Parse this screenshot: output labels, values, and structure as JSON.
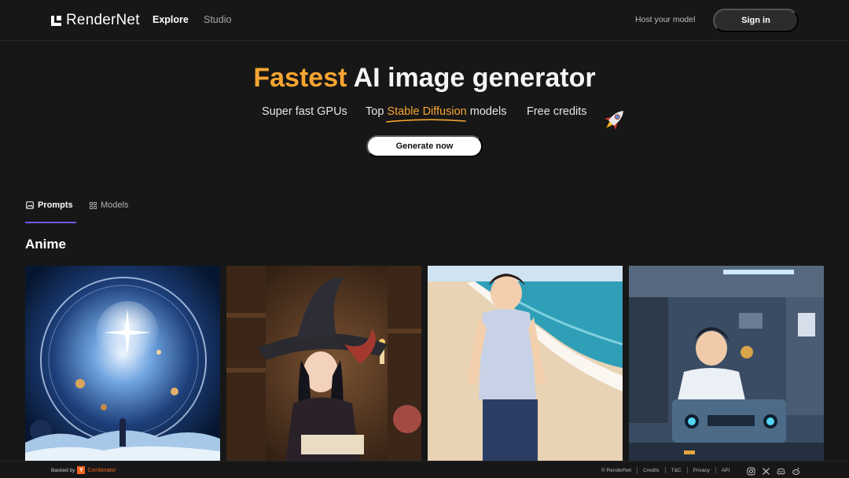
{
  "header": {
    "logo_text": "RenderNet",
    "nav": {
      "explore": "Explore",
      "studio": "Studio"
    },
    "host_link": "Host your model",
    "signin_label": "Sign in"
  },
  "hero": {
    "title_accent": "Fastest",
    "title_rest": " AI image generator",
    "feature_1": "Super fast GPUs",
    "feature_2_prefix": "Top ",
    "feature_2_highlight": "Stable Diffusion",
    "feature_2_suffix": " models",
    "feature_3": "Free credits",
    "cta_label": "Generate now"
  },
  "tabs": {
    "prompts": "Prompts",
    "models": "Models",
    "active": "prompts"
  },
  "section": {
    "title": "Anime"
  },
  "gallery": [
    {
      "name": "cosmic-sphere-image",
      "icon": "image"
    },
    {
      "name": "witch-girl-image",
      "icon": "image"
    },
    {
      "name": "beach-boy-image",
      "icon": "image"
    },
    {
      "name": "workshop-boy-image",
      "icon": "image"
    }
  ],
  "footer": {
    "backed_by": "Backed by",
    "yc_letter": "Y",
    "yc_name": "Combinator",
    "links": [
      "© RenderNet",
      "Credits",
      "T&C",
      "Privacy",
      "API"
    ],
    "socials": [
      "instagram-icon",
      "x-icon",
      "discord-icon",
      "reddit-icon"
    ]
  },
  "colors": {
    "accent": "#f7a531",
    "tab_indicator": "#6d5cf0",
    "yc": "#f26522",
    "background": "#171717"
  }
}
